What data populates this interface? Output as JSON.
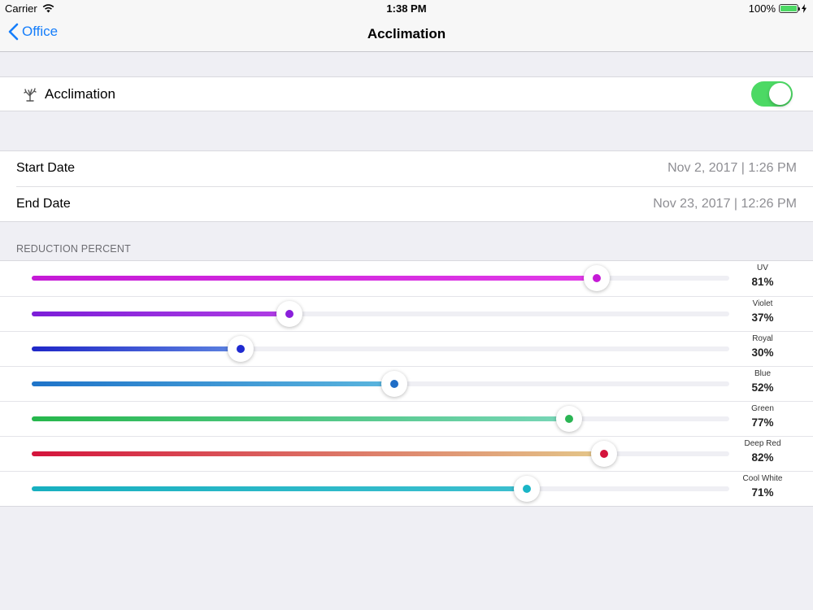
{
  "status_bar": {
    "carrier": "Carrier",
    "time": "1:38 PM",
    "battery": "100%",
    "battery_level": 1.0
  },
  "nav": {
    "back_label": "Office",
    "title": "Acclimation"
  },
  "toggle": {
    "label": "Acclimation",
    "on": true,
    "on_color": "#4cd964"
  },
  "dates": {
    "start_label": "Start Date",
    "start_value": "Nov 2, 2017 | 1:26 PM",
    "end_label": "End Date",
    "end_value": "Nov 23, 2017 | 12:26 PM"
  },
  "reduction": {
    "header": "REDUCTION PERCENT",
    "channels": [
      {
        "name": "UV",
        "percent_label": "81%",
        "value": 0.81,
        "color_start": "#c51ad6",
        "color_end": "#e23be8",
        "dot_color": "#c51ad6"
      },
      {
        "name": "Violet",
        "percent_label": "37%",
        "value": 0.37,
        "color_start": "#7c1ed8",
        "color_end": "#b13de4",
        "dot_color": "#8a1fdb"
      },
      {
        "name": "Royal",
        "percent_label": "30%",
        "value": 0.3,
        "color_start": "#1f27c8",
        "color_end": "#5d84e0",
        "dot_color": "#1f2ad0"
      },
      {
        "name": "Blue",
        "percent_label": "52%",
        "value": 0.52,
        "color_start": "#1f74c9",
        "color_end": "#5bb6de",
        "dot_color": "#1f6dc6"
      },
      {
        "name": "Green",
        "percent_label": "77%",
        "value": 0.77,
        "color_start": "#26b74c",
        "color_end": "#78d6b8",
        "dot_color": "#2bb554"
      },
      {
        "name": "Deep Red",
        "percent_label": "82%",
        "value": 0.82,
        "color_start": "#d4143c",
        "color_end": "#e4c88a",
        "dot_color": "#d4143c"
      },
      {
        "name": "Cool White",
        "percent_label": "71%",
        "value": 0.71,
        "color_start": "#18b0c0",
        "color_end": "#3cbfcf",
        "dot_color": "#1ab5c6"
      }
    ]
  }
}
